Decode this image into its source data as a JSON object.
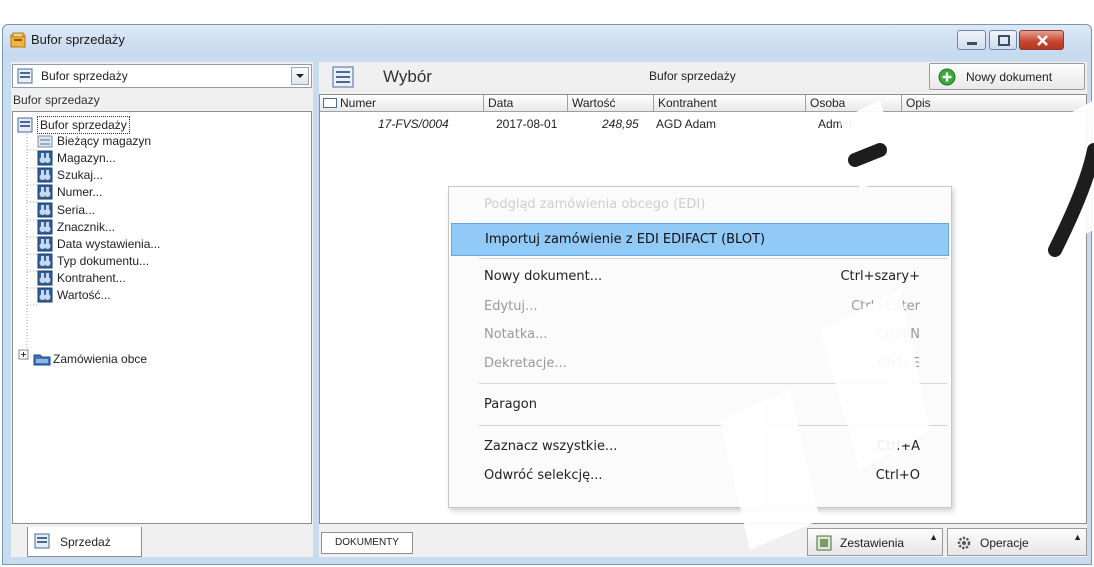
{
  "window": {
    "title": "Bufor sprzedaży",
    "accent_color": "#c9dcef",
    "controls": [
      "minimize-icon",
      "maximize-icon",
      "close-icon"
    ]
  },
  "left_panel": {
    "combo_value": "Bufor sprzedaży",
    "caption": "Bufor sprzedazy",
    "tree": {
      "root": "Bufor sprzedaży",
      "items": [
        {
          "label": "Bieżący magazyn",
          "icon": "warehouse-icon"
        },
        {
          "label": "Magazyn...",
          "icon": "binoculars-icon"
        },
        {
          "label": "Szukaj...",
          "icon": "binoculars-icon"
        },
        {
          "label": "Numer...",
          "icon": "binoculars-icon"
        },
        {
          "label": "Seria...",
          "icon": "binoculars-icon"
        },
        {
          "label": "Znacznik...",
          "icon": "binoculars-icon"
        },
        {
          "label": "Data wystawienia...",
          "icon": "binoculars-icon"
        },
        {
          "label": "Typ dokumentu...",
          "icon": "binoculars-icon"
        },
        {
          "label": "Kontrahent...",
          "icon": "binoculars-icon"
        },
        {
          "label": "Wartość...",
          "icon": "binoculars-icon"
        },
        {
          "label": "Zamówienia obce",
          "icon": "folder-icon"
        }
      ]
    },
    "tab": "Sprzedaż"
  },
  "right_panel": {
    "view_label": "Wybór",
    "list_title": "Bufor sprzedaży",
    "new_document_button": "Nowy dokument",
    "columns": [
      "Numer",
      "Data",
      "Wartość",
      "Kontrahent",
      "Osoba",
      "Opis"
    ],
    "rows": [
      {
        "numer": "17-FVS/0004",
        "data": "2017-08-01",
        "wartosc": "248,95",
        "kontrahent": "AGD Adam",
        "osoba": "Admin",
        "opis": ""
      }
    ],
    "footer": {
      "documents_tab": "DOKUMENTY",
      "reports_button": "Zestawienia",
      "operations_button": "Operacje"
    }
  },
  "context_menu": {
    "highlight_color": "#91c9f7",
    "items": [
      {
        "label": "Podgląd zamówienia obcego (EDI)",
        "shortcut": "",
        "state": "faded"
      },
      {
        "label": "Importuj zamówienie z EDI EDIFACT (BLOT)",
        "shortcut": "",
        "state": "highlight"
      },
      {
        "label": "Nowy dokument...",
        "shortcut": "Ctrl+szary+",
        "state": "enabled"
      },
      {
        "label": "Edytuj...",
        "shortcut": "Ctrl+Enter",
        "state": "disabled"
      },
      {
        "label": "Notatka...",
        "shortcut": "Ctrl+N",
        "state": "disabled"
      },
      {
        "label": "Dekretacje...",
        "shortcut": "Ctrl+E",
        "state": "disabled"
      },
      {
        "label": "Paragon",
        "shortcut": "",
        "state": "enabled"
      },
      {
        "label": "Zaznacz wszystkie...",
        "shortcut": "Ctrl+A",
        "state": "enabled"
      },
      {
        "label": "Odwróć selekcję...",
        "shortcut": "Ctrl+O",
        "state": "enabled"
      }
    ]
  }
}
